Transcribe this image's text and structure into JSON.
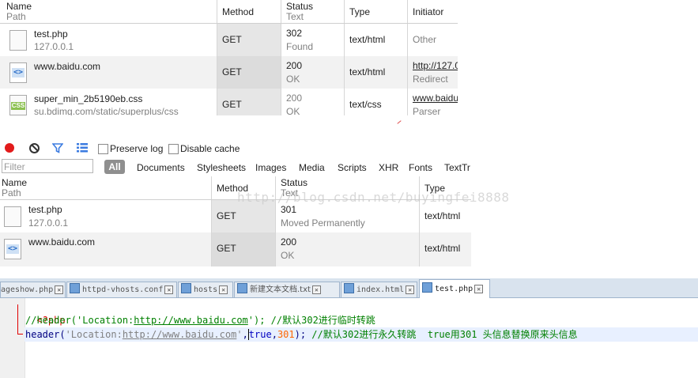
{
  "top_table": {
    "columns": [
      {
        "l1": "Name",
        "l2": "Path"
      },
      {
        "l1": "Method",
        "l2": ""
      },
      {
        "l1": "Status",
        "l2": "Text"
      },
      {
        "l1": "Type",
        "l2": ""
      },
      {
        "l1": "Initiator",
        "l2": ""
      }
    ],
    "rows": [
      {
        "name": "test.php",
        "path": "127.0.0.1",
        "method": "GET",
        "status": "302",
        "text": "Found",
        "type": "text/html",
        "initiator": "Other",
        "initiator2": "",
        "icon": "file-icon"
      },
      {
        "name": "www.baidu.com",
        "path": "",
        "method": "GET",
        "status": "200",
        "text": "OK",
        "type": "text/html",
        "initiator": "http://127.0",
        "initiator2": "Redirect",
        "icon": "html-file-icon"
      },
      {
        "name": "super_min_2b5190eb.css",
        "path": "su.bdimg.com/static/superplus/css",
        "method": "GET",
        "status": "200",
        "text": "OK",
        "type": "text/css",
        "initiator": "www.baidu",
        "initiator2": "Parser",
        "icon": "css-file-icon"
      }
    ]
  },
  "toolbar": {
    "preserve_log": "Preserve log",
    "disable_cache": "Disable cache",
    "filter_placeholder": "Filter",
    "all": "All",
    "types": [
      "Documents",
      "Stylesheets",
      "Images",
      "Media",
      "Scripts",
      "XHR",
      "Fonts",
      "TextTr"
    ]
  },
  "bottom_table": {
    "columns": [
      {
        "l1": "Name",
        "l2": "Path"
      },
      {
        "l1": "Method",
        "l2": ""
      },
      {
        "l1": "Status",
        "l2": "Text"
      },
      {
        "l1": "Type",
        "l2": ""
      }
    ],
    "rows": [
      {
        "name": "test.php",
        "path": "127.0.0.1",
        "method": "GET",
        "status": "301",
        "text": "Moved Permanently",
        "type": "text/html",
        "icon": "file-icon"
      },
      {
        "name": "www.baidu.com",
        "path": "",
        "method": "GET",
        "status": "200",
        "text": "OK",
        "type": "text/html",
        "icon": "html-file-icon"
      }
    ]
  },
  "watermark": "http://blog.csdn.net/buyingfei8888",
  "editor": {
    "tabs": [
      "ageshow.php",
      "httpd-vhosts.conf",
      "hosts",
      "新建文本文档.txt",
      "index.html",
      "test.php"
    ],
    "active_tab": "test.php",
    "code": {
      "line1": "<?php",
      "line2_comment": "//header('Location:",
      "line2_url": "http://www.baidu.com",
      "line2_rest": "'); //默认302进行临时转跳",
      "line3_fn": "header(",
      "line3_str1": "'Location:",
      "line3_url": "http://www.baidu.com",
      "line3_str2": "'",
      "line3_comma1": ",",
      "line3_true": "true",
      "line3_comma2": ",",
      "line3_num": "301",
      "line3_close": ");",
      "line3_comment": " //默认302进行永久转跳  true用301 头信息替换原来头信息"
    }
  }
}
